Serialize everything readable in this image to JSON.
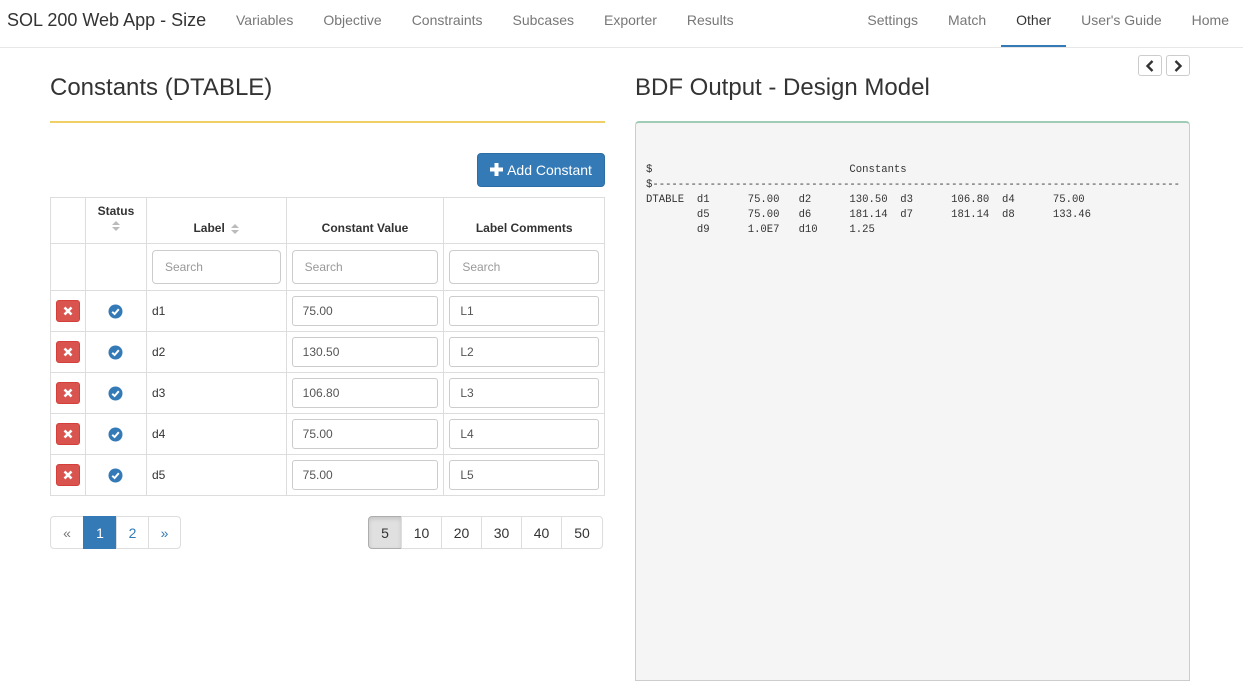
{
  "navbar": {
    "brand": "SOL 200 Web App - Size",
    "left_items": [
      "Variables",
      "Objective",
      "Constraints",
      "Subcases",
      "Exporter",
      "Results"
    ],
    "right_items": [
      "Settings",
      "Match",
      "Other",
      "User's Guide",
      "Home"
    ],
    "active_item": "Other"
  },
  "left_panel": {
    "title": "Constants (DTABLE)",
    "add_button_label": "Add Constant",
    "columns": {
      "status": "Status",
      "label": "Label",
      "value": "Constant Value",
      "comments": "Label Comments"
    },
    "search_placeholder": "Search",
    "rows": [
      {
        "label": "d1",
        "value": "75.00",
        "comment": "L1"
      },
      {
        "label": "d2",
        "value": "130.50",
        "comment": "L2"
      },
      {
        "label": "d3",
        "value": "106.80",
        "comment": "L3"
      },
      {
        "label": "d4",
        "value": "75.00",
        "comment": "L4"
      },
      {
        "label": "d5",
        "value": "75.00",
        "comment": "L5"
      }
    ],
    "pagination": {
      "prev": "«",
      "pages": [
        "1",
        "2"
      ],
      "next": "»",
      "current": "1"
    },
    "page_sizes": [
      "5",
      "10",
      "20",
      "30",
      "40",
      "50"
    ],
    "page_size_selected": "5"
  },
  "right_panel": {
    "title": "BDF Output - Design Model",
    "bdf_text": "$                               Constants\n$-----------------------------------------------------------------------------------\nDTABLE  d1      75.00   d2      130.50  d3      106.80  d4      75.00\n        d5      75.00   d6      181.14  d7      181.14  d8      133.46\n        d9      1.0E7   d10     1.25"
  },
  "colors": {
    "primary": "#337ab7",
    "danger": "#d9534f",
    "title_rule": "#f0cf65",
    "bdf_border_top": "#9fcbb7"
  },
  "icons": {
    "prev_arrow": "chevron-left-icon",
    "next_arrow": "chevron-right-icon",
    "delete": "x-icon",
    "status": "check-circle-icon",
    "sort": "sort-icon",
    "add": "plus-icon"
  }
}
